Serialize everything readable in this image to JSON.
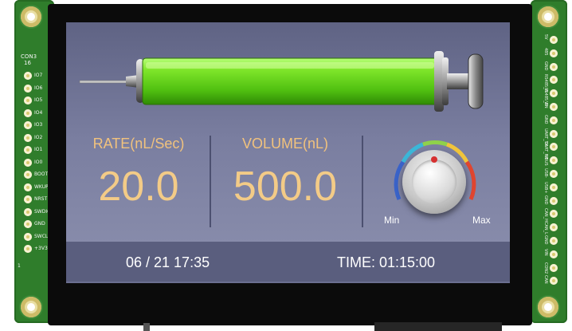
{
  "board": {
    "left_header_title": "CON3",
    "left_header_pin_count": "16",
    "left_pins": [
      "IO7",
      "IO6",
      "IO5",
      "IO4",
      "IO3",
      "IO2",
      "IO1",
      "IO0",
      "BOOT0",
      "WKUP",
      "NRST",
      "SWDIO",
      "GND",
      "SWCLK",
      "+3V3"
    ],
    "left_pin_one": "1",
    "right_pins": [
      "5V",
      "485",
      "GND",
      "RS485_A",
      "RS485_B",
      "VIN",
      "GND",
      "UART_TX",
      "UART_RX",
      "VBUS",
      "USB-",
      "USB+",
      "GND",
      "CAN_H",
      "CAN_L",
      "GND",
      "VIN",
      "CON2",
      "CAN"
    ]
  },
  "rate": {
    "label": "RATE(nL/Sec)",
    "value": "20.0"
  },
  "volume": {
    "label": "VOLUME(nL)",
    "value": "500.0"
  },
  "knob": {
    "min_label": "Min",
    "max_label": "Max",
    "level": 0.5
  },
  "status_bar": {
    "datetime": "06 / 21  17:35",
    "time_label": "TIME:  01:15:00"
  },
  "syringe": {
    "fill_color": "#66d411",
    "fill_fraction": 1.0
  }
}
